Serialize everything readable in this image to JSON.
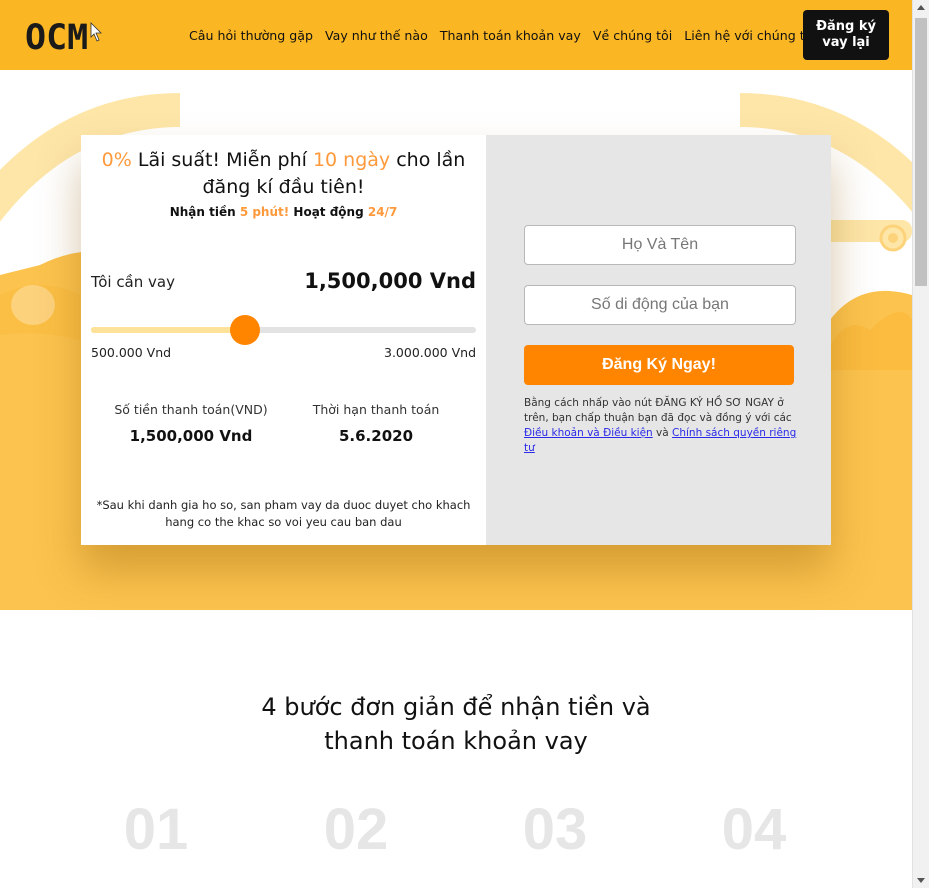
{
  "header": {
    "logo_text": "OCM",
    "nav": [
      "Câu hỏi thường gặp",
      "Vay như thế nào",
      "Thanh toán khoản vay",
      "Về chúng tôi",
      "Liên hệ với chúng tôi"
    ],
    "cta_label": "Đăng ký vay lại"
  },
  "colors": {
    "brand_yellow": "#fbb623",
    "accent_orange": "#ff8500",
    "highlight": "#ff9a3c",
    "card_right_bg": "#e6e6e6"
  },
  "hero": {
    "headline": {
      "rate": "0%",
      "part1": " Lãi suất! Miễn phí ",
      "days": "10 ngày",
      "part2": " cho lần đăng kí đầu tiên!"
    },
    "subline": {
      "part1": "Nhận tiền ",
      "minutes": "5 phút!",
      "part2": " Hoạt động ",
      "hours": "24/7"
    },
    "loan": {
      "label": "Tôi cần vay",
      "value": "1,500,000 Vnd",
      "min_label": "500.000 Vnd",
      "max_label": "3.000.000 Vnd",
      "slider_fraction": 0.4
    },
    "stats": {
      "amount_label": "Số tiền thanh toán(VND)",
      "amount_value": "1,500,000 Vnd",
      "term_label": "Thời hạn thanh toán",
      "term_value": "5.6.2020"
    },
    "note": "*Sau khi danh gia ho so, san pham vay da duoc duyet cho khach hang co the khac so voi yeu cau ban dau"
  },
  "form": {
    "name_placeholder": "Họ Và Tên",
    "phone_placeholder": "Số di động của bạn",
    "submit_label": "Đăng Ký Ngay!",
    "consent_text": "Bằng cách nhấp vào nút ĐĂNG KÝ HỒ SƠ NGAY ở trên, bạn chấp thuận bạn đã đọc và đồng ý với các ",
    "terms_link": "Điều khoản và Điều kiện",
    "and_word": " và ",
    "privacy_link": "Chính sách quyền riêng tư"
  },
  "steps": {
    "title": "4 bước đơn giản để nhận tiền và thanh toán khoản vay",
    "numbers": [
      "01",
      "02",
      "03",
      "04"
    ]
  }
}
